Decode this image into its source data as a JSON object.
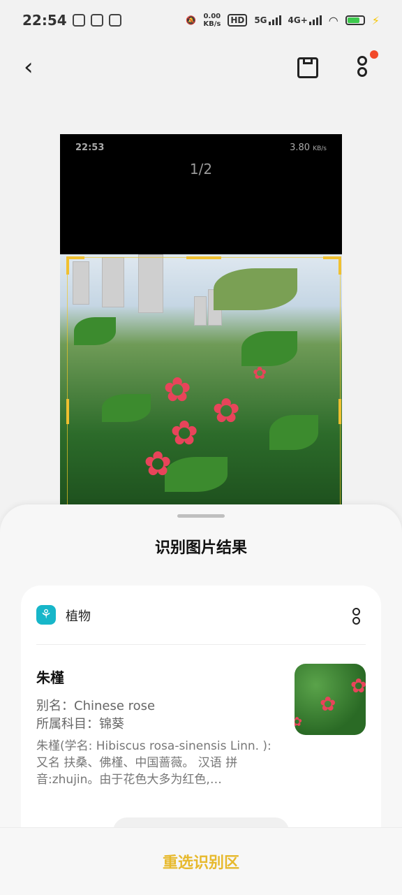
{
  "status_bar": {
    "time": "22:54",
    "net_speed_value": "0.00",
    "net_speed_unit": "KB/s",
    "hd_label": "HD",
    "net_5g": "5G",
    "net_4g": "4G+"
  },
  "preview": {
    "inner_time": "22:53",
    "inner_speed": "3.80",
    "inner_speed_unit": "KB/s",
    "page_indicator": "1/2"
  },
  "sheet": {
    "title": "识别图片结果",
    "category": "植物",
    "plant_name": "朱槿",
    "alias_line": "别名：Chinese rose",
    "family_line": "所属科目：锦葵",
    "description": "朱槿(学名: Hibiscus rosa-sinensis Linn. ):又名 扶桑、佛槿、中国蔷薇。 汉语 拼音:zhujin。由于花色大多为红色,…"
  },
  "bottom": {
    "reselect_label": "重选识别区"
  },
  "colors": {
    "accent": "#e7b92c",
    "category_icon": "#17b6c9",
    "notification_dot": "#f24a2a"
  },
  "icons": [
    "back-icon",
    "save-icon",
    "more-icon",
    "plant-icon"
  ]
}
